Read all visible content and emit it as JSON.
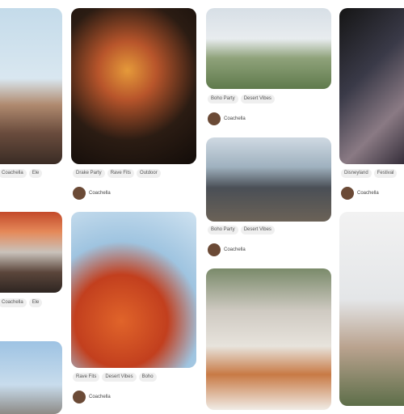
{
  "pins": [
    {
      "tags": [
        "Coachella"
      ],
      "author": ""
    },
    {
      "tags": [
        "Drake Party",
        "Rave Fits",
        "Outdoor"
      ],
      "author": "Coachella"
    },
    {
      "tags": [
        "Boho Party",
        "Desert Vibes"
      ],
      "author": "Coachella"
    },
    {
      "tags": [
        "Boho Party",
        "Desert Vibes"
      ],
      "author": "Coachella"
    },
    {
      "tags": [
        "Disneyland",
        "Festival"
      ],
      "author": "Coachella"
    },
    {
      "tags": [
        "Rave Fits",
        "Desert Vibes",
        "Boho"
      ],
      "author": "Coachella"
    }
  ]
}
